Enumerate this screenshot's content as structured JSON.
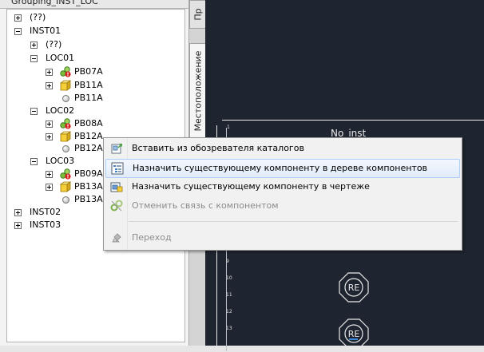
{
  "panel": {
    "title": "Grouping_INST_LOC"
  },
  "tabs": [
    {
      "label": "Пр"
    },
    {
      "label": "Местоположение"
    }
  ],
  "tree": [
    {
      "label": "(??)",
      "expander": "plus"
    },
    {
      "label": "INST01",
      "expander": "minus"
    },
    {
      "label": "(??)",
      "expander": "plus"
    },
    {
      "label": "LOC01",
      "expander": "minus"
    },
    {
      "label": "PB07A",
      "expander": "plus",
      "icon": "component-linked-error-icon"
    },
    {
      "label": "PB11A",
      "expander": "plus",
      "icon": "yellow-box-icon"
    },
    {
      "label": "PB11A",
      "expander": "none",
      "icon": "circle-icon"
    },
    {
      "label": "LOC02",
      "expander": "minus"
    },
    {
      "label": "PB08A",
      "expander": "plus",
      "icon": "component-linked-error-icon"
    },
    {
      "label": "PB12A",
      "expander": "plus",
      "icon": "yellow-box-icon"
    },
    {
      "label": "PB12A",
      "expander": "none",
      "icon": "circle-icon"
    },
    {
      "label": "LOC03",
      "expander": "minus"
    },
    {
      "label": "PB09A",
      "expander": "plus",
      "icon": "component-linked-error-icon"
    },
    {
      "label": "PB13A",
      "expander": "plus",
      "icon": "yellow-box-icon"
    },
    {
      "label": "PB13A",
      "expander": "none",
      "icon": "circle-icon"
    },
    {
      "label": "INST02",
      "expander": "plus"
    },
    {
      "label": "INST03",
      "expander": "plus"
    }
  ],
  "canvas": {
    "title": "No_inst",
    "row_numbers": [
      "1",
      "9",
      "10",
      "11",
      "12",
      "13"
    ],
    "symbol_label": "RE"
  },
  "context_menu": {
    "items": [
      {
        "label": "Вставить из обозревателя каталогов",
        "enabled": true,
        "icon": "catalog-insert-icon"
      },
      {
        "label": "Назначить существующему компоненту в дереве компонентов",
        "enabled": true,
        "icon": "assign-tree-icon",
        "highlighted": true
      },
      {
        "label": "Назначить существующему компоненту в чертеже",
        "enabled": true,
        "icon": "assign-drawing-icon"
      },
      {
        "label": "Отменить связь с компонентом",
        "enabled": false,
        "icon": "unlink-icon"
      },
      {
        "label": "Переход",
        "enabled": false,
        "icon": "goto-icon"
      }
    ]
  },
  "colors": {
    "canvas_bg": "#1f2530",
    "menu_highlight": "#e1ecfa",
    "disabled_text": "#8d8d8d"
  }
}
